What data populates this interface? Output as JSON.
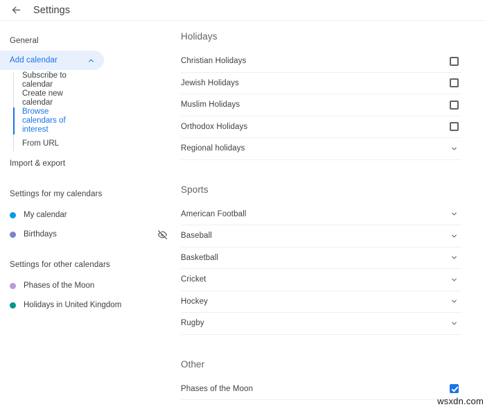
{
  "header": {
    "back_icon": "arrow-left-icon",
    "title": "Settings"
  },
  "sidebar": {
    "general_label": "General",
    "add_calendar": {
      "label": "Add calendar",
      "expanded": true,
      "chevron_icon": "chevron-up-icon",
      "sub_items": [
        {
          "label": "Subscribe to calendar",
          "active": false
        },
        {
          "label": "Create new calendar",
          "active": false
        },
        {
          "label": "Browse calendars of interest",
          "active": true
        },
        {
          "label": "From URL",
          "active": false
        }
      ]
    },
    "import_export_label": "Import & export",
    "my_calendars": {
      "title": "Settings for my calendars",
      "items": [
        {
          "label": "My calendar",
          "color": "#039be5",
          "visibility_icon": ""
        },
        {
          "label": "Birthdays",
          "color": "#7986cb",
          "visibility_icon": "visibility-off-icon"
        }
      ]
    },
    "other_calendars": {
      "title": "Settings for other calendars",
      "items": [
        {
          "label": "Phases of the Moon",
          "color": "#b39ddb",
          "visibility_icon": ""
        },
        {
          "label": "Holidays in United Kingdom",
          "color": "#009688",
          "visibility_icon": ""
        }
      ]
    }
  },
  "main": {
    "groups": [
      {
        "title": "Holidays",
        "rows": [
          {
            "label": "Christian Holidays",
            "control": "checkbox",
            "checked": false
          },
          {
            "label": "Jewish Holidays",
            "control": "checkbox",
            "checked": false
          },
          {
            "label": "Muslim Holidays",
            "control": "checkbox",
            "checked": false
          },
          {
            "label": "Orthodox Holidays",
            "control": "checkbox",
            "checked": false
          },
          {
            "label": "Regional holidays",
            "control": "chevron",
            "checked": false
          }
        ]
      },
      {
        "title": "Sports",
        "rows": [
          {
            "label": "American Football",
            "control": "chevron",
            "checked": false
          },
          {
            "label": "Baseball",
            "control": "chevron",
            "checked": false
          },
          {
            "label": "Basketball",
            "control": "chevron",
            "checked": false
          },
          {
            "label": "Cricket",
            "control": "chevron",
            "checked": false
          },
          {
            "label": "Hockey",
            "control": "chevron",
            "checked": false
          },
          {
            "label": "Rugby",
            "control": "chevron",
            "checked": false
          }
        ]
      },
      {
        "title": "Other",
        "rows": [
          {
            "label": "Phases of the Moon",
            "control": "checkbox",
            "checked": true
          }
        ]
      }
    ]
  },
  "watermark": {
    "text": "wsxdn.com"
  },
  "colors": {
    "accent": "#1a73e8",
    "accent_bg": "#e8f0fe",
    "text": "#3c4043",
    "muted": "#5f6368",
    "divider": "#eceff1"
  }
}
